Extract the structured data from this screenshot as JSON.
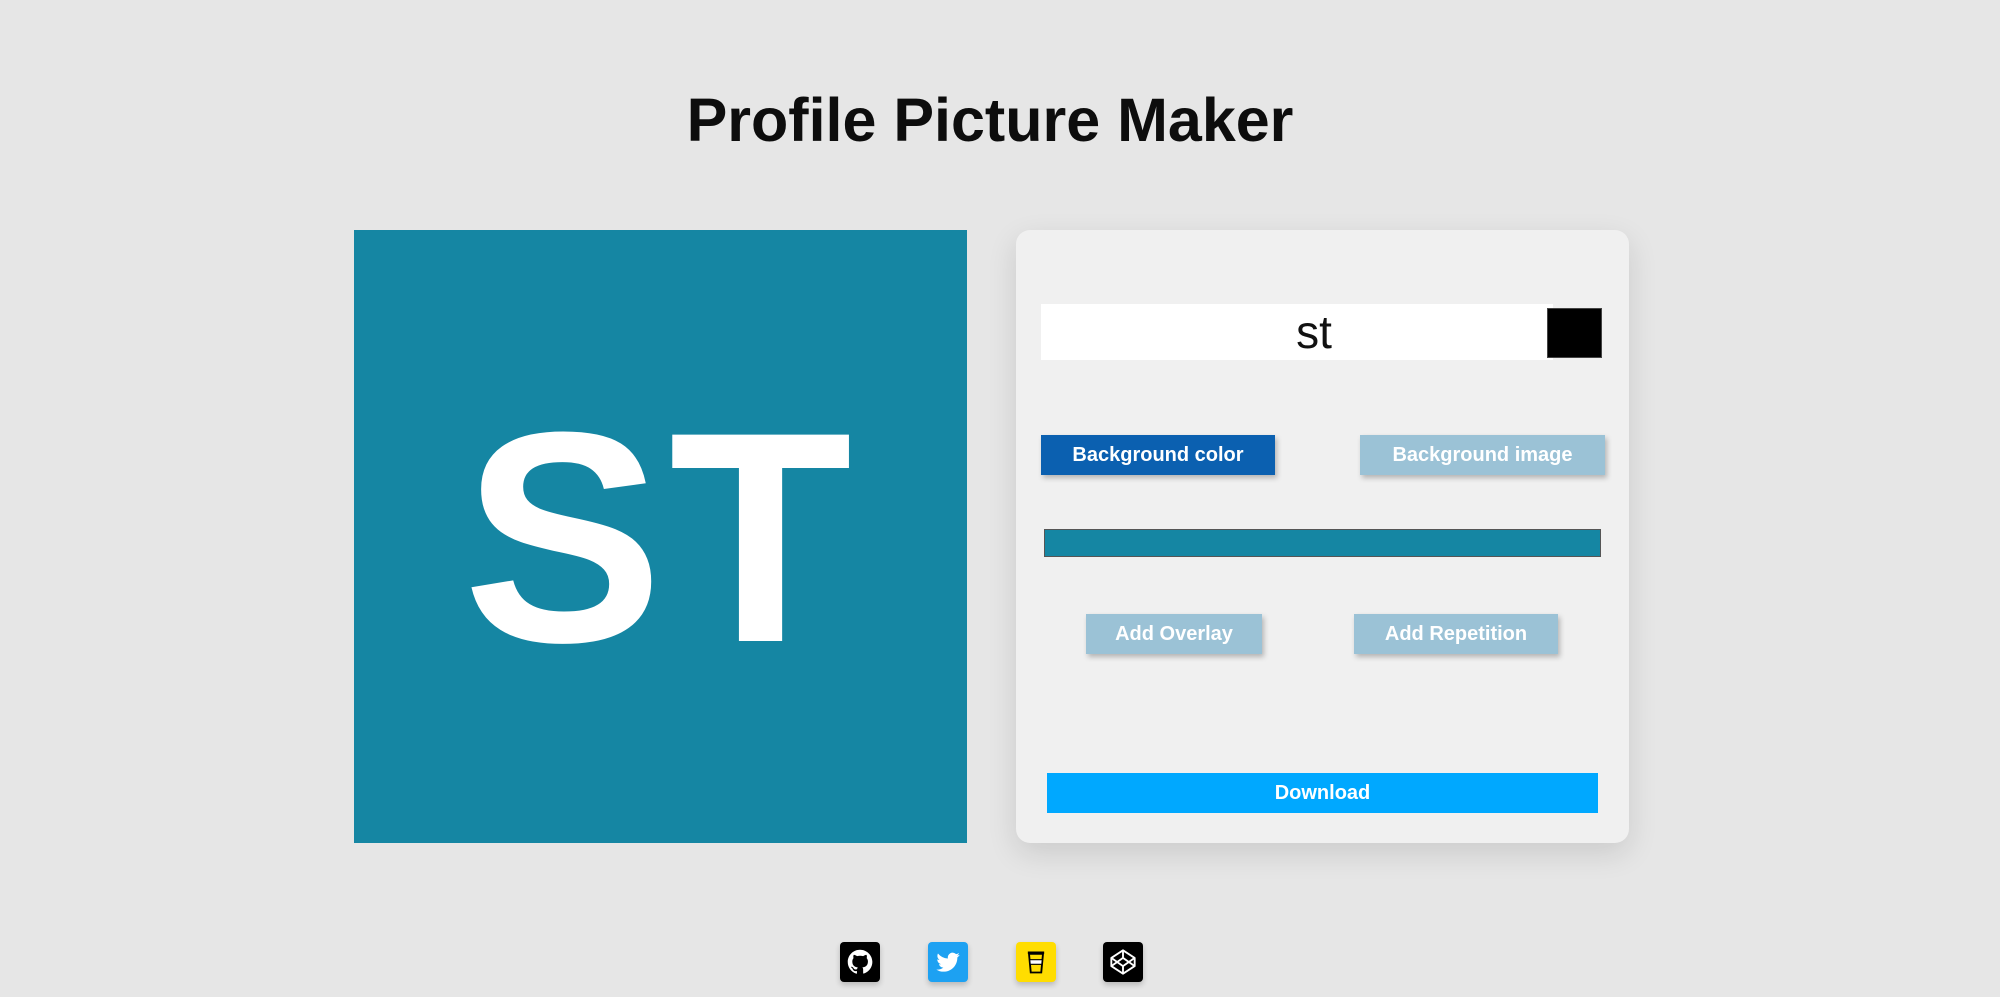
{
  "title": "Profile Picture Maker",
  "preview": {
    "text": "ST",
    "background_color": "#1586a3",
    "text_color": "#ffffff"
  },
  "controls": {
    "text_input_value": "st",
    "text_color": "#000000",
    "background_color_label": "Background color",
    "background_image_label": "Background image",
    "background_color_value": "#1586a3",
    "add_overlay_label": "Add Overlay",
    "add_repetition_label": "Add Repetition",
    "download_label": "Download"
  },
  "social": {
    "icons": [
      "github-icon",
      "twitter-icon",
      "buymeacoffee-icon",
      "codepen-icon"
    ]
  }
}
